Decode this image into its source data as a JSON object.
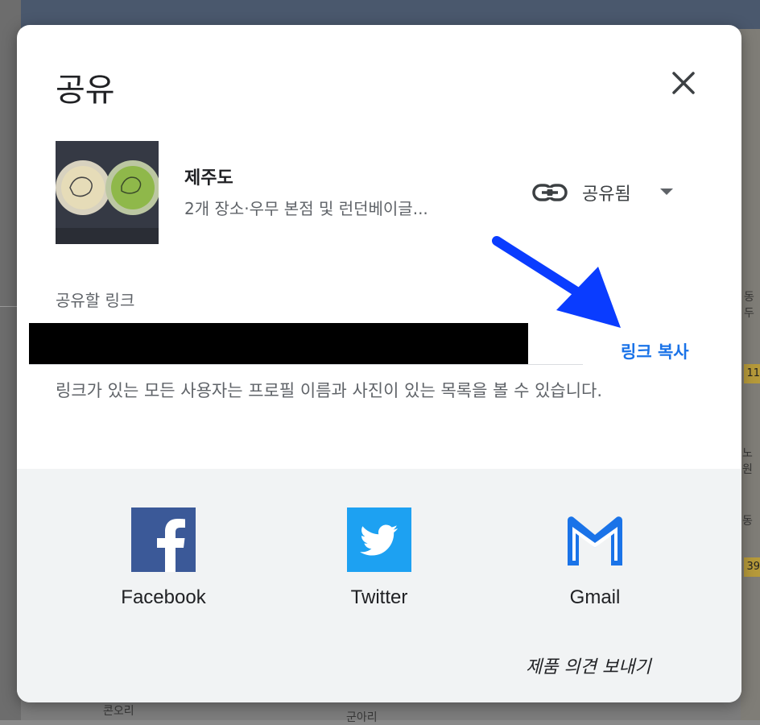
{
  "dialog": {
    "title": "공유",
    "list": {
      "name": "제주도",
      "description": "2개 장소·우무 본점 및 런던베이글..."
    },
    "share_status": {
      "label": "공유됨",
      "icon": "link-icon"
    },
    "link_section": {
      "label": "공유할 링크",
      "copy_label": "링크 복사",
      "note": "링크가 있는 모든 사용자는 프로필 이름과 사진이 있는 목록을 볼 수 있습니다."
    },
    "social": [
      {
        "name": "Facebook",
        "icon": "facebook-icon",
        "color": "#3b5998"
      },
      {
        "name": "Twitter",
        "icon": "twitter-icon",
        "color": "#1da1f2"
      },
      {
        "name": "Gmail",
        "icon": "gmail-icon",
        "color": "#1a73e8"
      }
    ],
    "feedback_label": "제품 의견 보내기"
  },
  "map": {
    "labels": [
      "동두",
      "11",
      "노원",
      "동",
      "39",
      "콘오리",
      "군아리"
    ]
  },
  "colors": {
    "accent": "#1a73e8",
    "annotation_arrow": "#0a3cff"
  }
}
